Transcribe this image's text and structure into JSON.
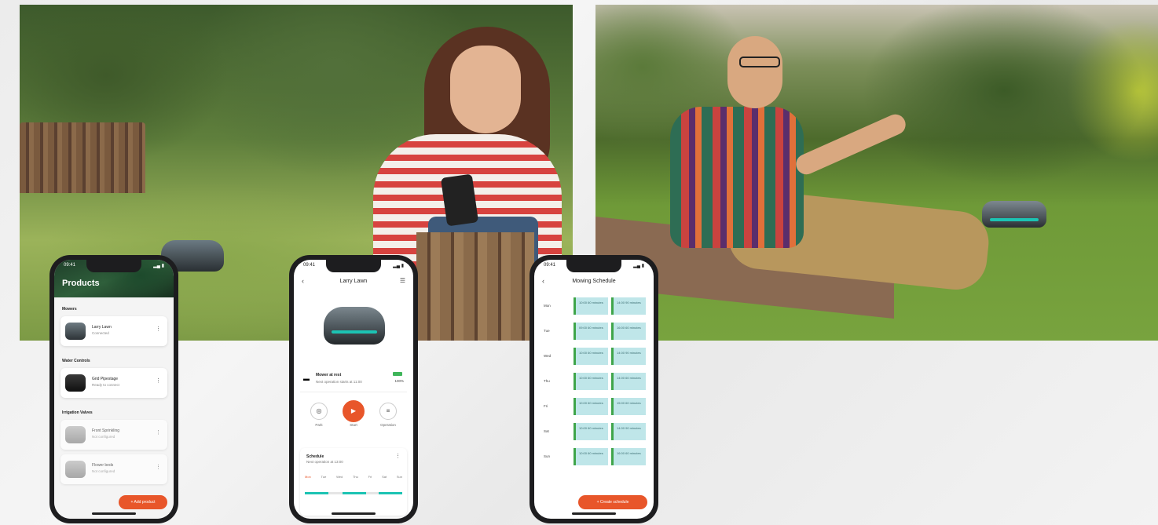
{
  "scene": {
    "left_photo": "woman-with-phone-and-robot-mower",
    "right_photo": "man-sitting-on-deck-with-phone-and-robot-mower"
  },
  "phone1": {
    "time": "09:41",
    "title": "Products",
    "sections": [
      "Mowers",
      "Water Controls",
      "Irrigation Valves"
    ],
    "items": [
      {
        "name": "Larry Lawn",
        "status": "Connected"
      },
      {
        "name": "Grid Pipestage",
        "status": "Ready to connect"
      },
      {
        "name": "Front Sprinkling",
        "status": "Not configured"
      },
      {
        "name": "Flower beds",
        "status": "Not configured"
      }
    ],
    "add_button": "+ Add product"
  },
  "phone2": {
    "time": "09:41",
    "title": "Larry Lawn",
    "status_title": "Mower at rest",
    "status_sub": "Next operation starts at 11:00",
    "battery": "100%",
    "controls": [
      "Park",
      "Start",
      "Operation"
    ],
    "schedule_title": "Schedule",
    "schedule_sub": "Next operation at 13:00",
    "days": [
      "Mon",
      "Tue",
      "Wed",
      "Thu",
      "Fri",
      "Sat",
      "Sun"
    ]
  },
  "phone3": {
    "time": "09:41",
    "title": "Mowing Schedule",
    "rows": [
      {
        "day": "Mon",
        "slot1": "10:00 60 minutes",
        "slot2": "14:00 90 minutes"
      },
      {
        "day": "Tue",
        "slot1": "09:00 60 minutes",
        "slot2": "16:00 60 minutes"
      },
      {
        "day": "Wed",
        "slot1": "10:00 60 minutes",
        "slot2": "14:00 90 minutes"
      },
      {
        "day": "Thu",
        "slot1": "10:00 60 minutes",
        "slot2": "14:00 60 minutes"
      },
      {
        "day": "Fri",
        "slot1": "10:00 60 minutes",
        "slot2": "15:00 60 minutes"
      },
      {
        "day": "Sat",
        "slot1": "10:00 60 minutes",
        "slot2": "14:00 90 minutes"
      },
      {
        "day": "Sun",
        "slot1": "10:00 60 minutes",
        "slot2": "16:00 60 minutes"
      }
    ],
    "create_button": "+ Create schedule"
  },
  "colors": {
    "accent": "#e8562a",
    "teal": "#1cc3b3",
    "slot": "#bfe6e9",
    "slot_border": "#3fa54a"
  }
}
